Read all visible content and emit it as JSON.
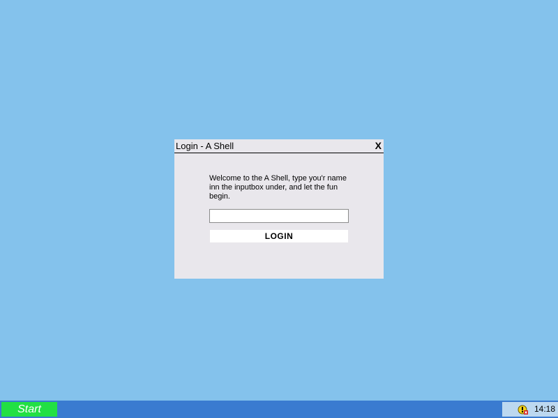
{
  "window": {
    "title": "Login - A Shell",
    "close_label": "X",
    "welcome_text": "Welcome to the A Shell, type you'r name inn the inputbox under, and let the fun begin.",
    "name_input_value": "",
    "login_label": "LOGIN"
  },
  "taskbar": {
    "start_label": "Start",
    "tray_icon": "shield-warning-icon",
    "clock": "14:18"
  },
  "colors": {
    "desktop": "#84c2ec",
    "window_bg": "#e9e7ec",
    "taskbar": "#3a7bd0",
    "start_button": "#22e044",
    "tray": "#bcd8f0"
  }
}
